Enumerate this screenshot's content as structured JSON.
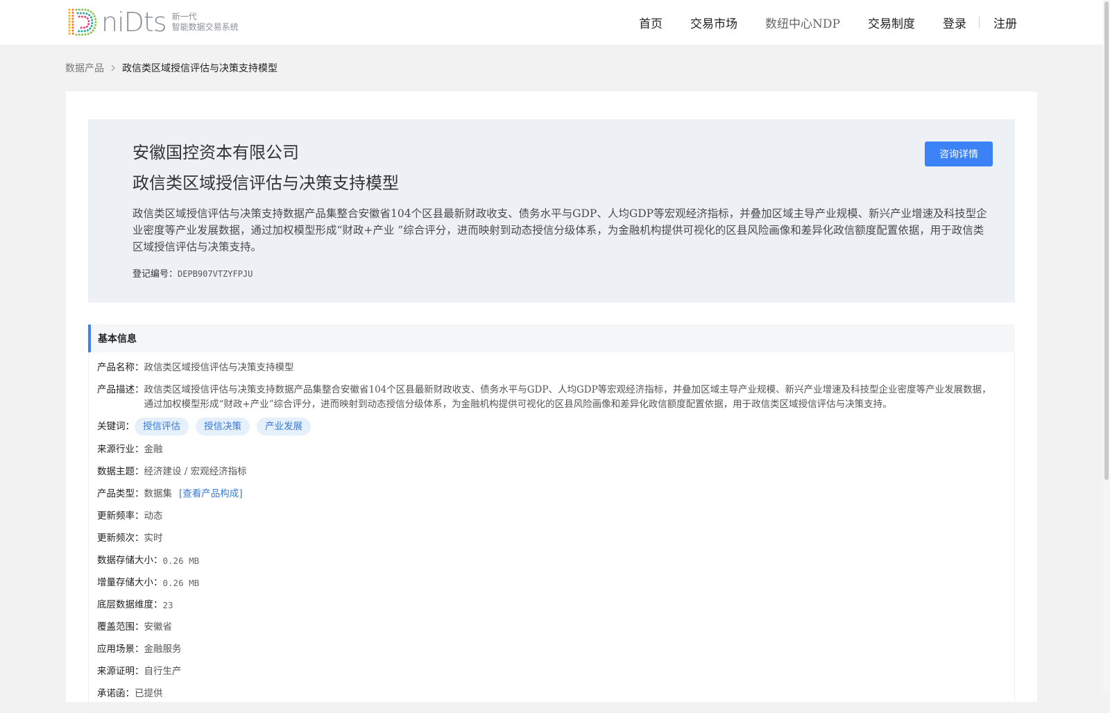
{
  "header": {
    "logo_text": "niDts",
    "logo_sub_line1": "新一代",
    "logo_sub_line2": "智能数据交易系统",
    "nav": [
      {
        "label": "首页"
      },
      {
        "label": "交易市场"
      },
      {
        "label": "数纽中心NDP"
      },
      {
        "label": "交易制度"
      },
      {
        "label": "登录"
      },
      {
        "label": "注册"
      }
    ]
  },
  "breadcrumb": {
    "parent": "数据产品",
    "current": "政信类区域授信评估与决策支持模型"
  },
  "hero": {
    "company": "安徽国控资本有限公司",
    "title": "政信类区域授信评估与决策支持模型",
    "description": "政信类区域授信评估与决策支持数据产品集整合安徽省104个区县最新财政收支、债务水平与GDP、人均GDP等宏观经济指标，并叠加区域主导产业规模、新兴产业增速及科技型企业密度等产业发展数据，通过加权模型形成“财政+产业 ”综合评分，进而映射到动态授信分级体系，为金融机构提供可视化的区县风险画像和差异化政信额度配置依据，用于政信类区域授信评估与决策支持。",
    "reg_label": "登记编号：",
    "reg_code": "DEPB907VTZYFPJU",
    "consult_label": "咨询详情"
  },
  "basic_info": {
    "heading": "基本信息",
    "product_name_label": "产品名称：",
    "product_name": "政信类区域授信评估与决策支持模型",
    "product_desc_label": "产品描述：",
    "product_desc": "政信类区域授信评估与决策支持数据产品集整合安徽省104个区县最新财政收支、债务水平与GDP、人均GDP等宏观经济指标，并叠加区域主导产业规模、新兴产业增速及科技型企业密度等产业发展数据，通过加权模型形成“财政+产业”综合评分，进而映射到动态授信分级体系，为金融机构提供可视化的区县风险画像和差异化政信额度配置依据，用于政信类区域授信评估与决策支持。",
    "keywords_label": "关键词：",
    "keywords": [
      "授信评估",
      "授信决策",
      "产业发展"
    ],
    "industry_label": "来源行业：",
    "industry": "金融",
    "theme_label": "数据主题：",
    "theme": "经济建设 / 宏观经济指标",
    "type_label": "产品类型：",
    "type": "数据集",
    "type_link": "[查看产品构成]",
    "freq_label": "更新频率：",
    "freq": "动态",
    "times_label": "更新频次：",
    "times": "实时",
    "storage_label": "数据存储大小：",
    "storage": "0.26 MB",
    "incr_label": "增量存储大小：",
    "incr": "0.26 MB",
    "dim_label": "底层数据维度：",
    "dim": "23",
    "coverage_label": "覆盖范围：",
    "coverage": "安徽省",
    "scene_label": "应用场景：",
    "scene": "金融服务",
    "proof_label": "来源证明：",
    "proof": "自行生产",
    "promise_label": "承诺函：",
    "promise": "已提供"
  },
  "colors": {
    "accent": "#3b82f6",
    "hero_bg": "#edf1f5",
    "page_bg": "#f2f2f2",
    "tag_bg": "#e6f0fb"
  }
}
